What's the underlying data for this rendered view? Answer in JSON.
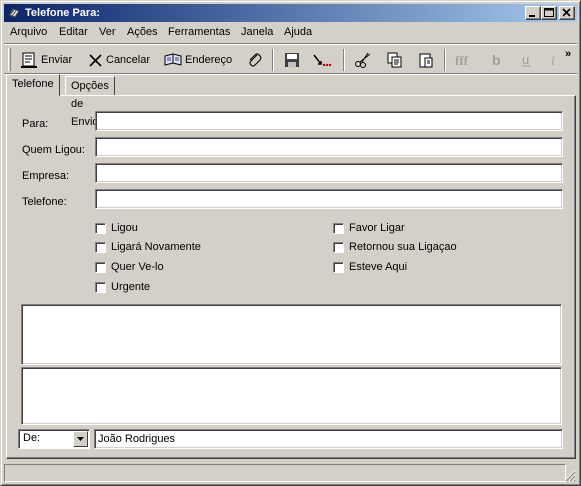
{
  "window": {
    "title": "Telefone Para:",
    "controls": {
      "minimize": "minimize",
      "maximize": "maximize",
      "close": "close"
    }
  },
  "menu": {
    "items": [
      {
        "label": "Arquivo"
      },
      {
        "label": "Editar"
      },
      {
        "label": "Ver"
      },
      {
        "label": "Ações"
      },
      {
        "label": "Ferramentas"
      },
      {
        "label": "Janela"
      },
      {
        "label": "Ajuda"
      }
    ]
  },
  "toolbar": {
    "send_label": "Enviar",
    "cancel_label": "Cancelar",
    "address_label": "Endereço",
    "overflow": "»",
    "icons": [
      "paperclip-icon",
      "save-icon",
      "mark-icon",
      "scissors-icon",
      "copy-icon",
      "paste-icon",
      "font-size-icon",
      "bold-icon",
      "underline-icon",
      "italic-icon"
    ]
  },
  "tabs": [
    {
      "label": "Telefone",
      "active": true
    },
    {
      "label": "Opções de Envio",
      "active": false
    }
  ],
  "form": {
    "para_label": "Para:",
    "para_value": "",
    "quem_ligou_label": "Quem Ligou:",
    "quem_ligou_value": "",
    "empresa_label": "Empresa:",
    "empresa_value": "",
    "telefone_label": "Telefone:",
    "telefone_value": ""
  },
  "checkboxes": {
    "left": [
      {
        "label": "Ligou",
        "checked": false
      },
      {
        "label": "Ligará Novamente",
        "checked": false
      },
      {
        "label": "Quer Ve-lo",
        "checked": false
      },
      {
        "label": "Urgente",
        "checked": false
      }
    ],
    "right": [
      {
        "label": "Favor Ligar",
        "checked": false
      },
      {
        "label": "Retornou sua Ligaçao",
        "checked": false
      },
      {
        "label": "Esteve Aqui",
        "checked": false
      }
    ]
  },
  "message": {
    "body1": "",
    "body2": ""
  },
  "footer": {
    "from_select": "De:",
    "from_value": "João Rodrigues"
  },
  "colors": {
    "titlebar_start": "#0a246a",
    "titlebar_end": "#a6caf0",
    "face": "#d4d0c8"
  }
}
